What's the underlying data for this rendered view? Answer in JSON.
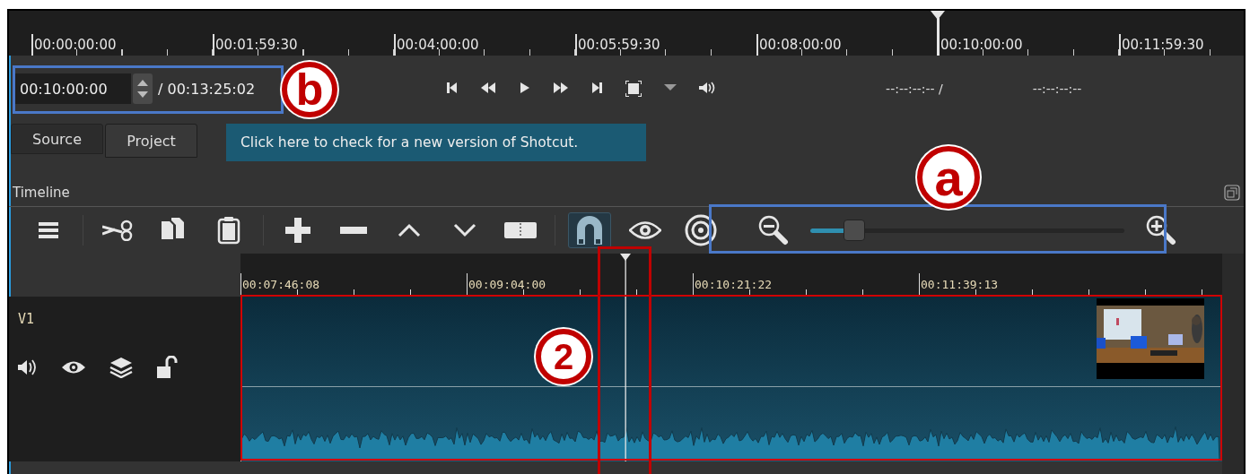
{
  "ruler": {
    "labels": [
      "00:00:00:00",
      "00:01:59:30",
      "00:04:00:00",
      "00:05:59:30",
      "00:08:00:00",
      "00:10:00:00",
      "00:11:59:30"
    ]
  },
  "timecode": {
    "value": "00:10:00:00",
    "total": "/ 00:13:25:02"
  },
  "in_point": "--:--:--:-- /",
  "out_point": "--:--:--:--",
  "tabs": [
    {
      "label": "Source",
      "selected": false
    },
    {
      "label": "Project",
      "selected": true
    }
  ],
  "notice": "Click here to check for a new version of Shotcut.",
  "timeline": {
    "title": "Timeline",
    "toggles": {
      "snap": true,
      "scrub": false,
      "ripple": false
    },
    "zoom": {
      "level": 0.14
    },
    "ruler_labels": [
      "00:07:46:08",
      "00:09:04:00",
      "00:10:21:22",
      "00:11:39:13"
    ],
    "track": {
      "name": "V1"
    }
  },
  "annotations": [
    {
      "label": "b"
    },
    {
      "label": "a"
    },
    {
      "label": "2"
    }
  ]
}
